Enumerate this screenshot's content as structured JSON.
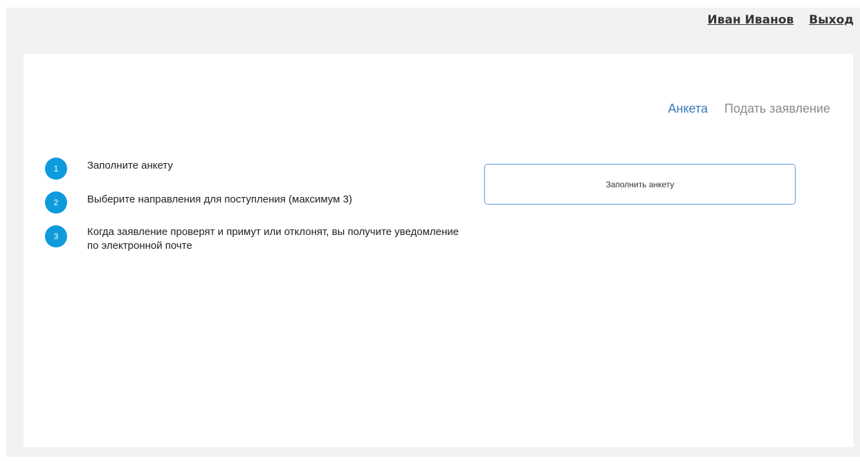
{
  "header": {
    "user_name": "Иван Иванов",
    "logout_label": "Выход"
  },
  "tabs": [
    {
      "label": "Анкета",
      "active": true
    },
    {
      "label": "Подать заявление",
      "active": false
    }
  ],
  "steps": [
    {
      "number": "1",
      "text": "Заполните анкету"
    },
    {
      "number": "2",
      "text": "Выберите направления для поступления (максимум 3)"
    },
    {
      "number": "3",
      "text": "Когда заявление проверят и примут или отклонят, вы получите уведомление по электронной почте"
    }
  ],
  "action": {
    "fill_form_label": "Заполнить анкету"
  },
  "colors": {
    "accent": "#0e9bdc",
    "active_tab": "#3a7ab8",
    "inactive_tab": "#8a8a8a",
    "button_border": "#5a9bd5",
    "page_background": "#f2f2f2"
  }
}
